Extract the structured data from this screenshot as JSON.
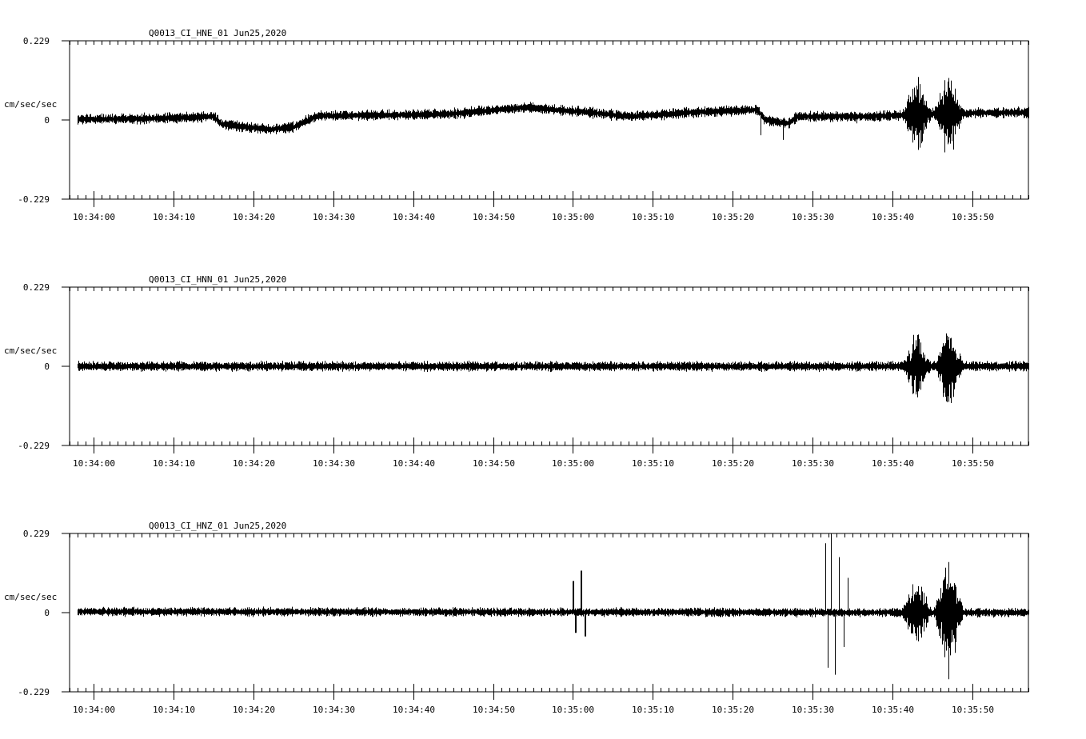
{
  "chart_data": [
    {
      "type": "line",
      "title": "Q0013_CI_HNE_01  Jun25,2020",
      "ylabel": "cm/sec/sec",
      "ylim": [
        -0.229,
        0.229
      ],
      "yticks": [
        "0.229",
        "0",
        "-0.229"
      ],
      "xlim": [
        "10:33:57",
        "10:35:57"
      ],
      "xticks": [
        "10:34:00",
        "10:34:10",
        "10:34:20",
        "10:34:30",
        "10:34:40",
        "10:34:50",
        "10:35:00",
        "10:35:10",
        "10:35:20",
        "10:35:30",
        "10:35:40",
        "10:35:50"
      ],
      "grid": false,
      "series": [
        {
          "color": "#000000",
          "trace_start_s": 1.0,
          "trace_end_s": 120.0,
          "baseline": [
            [
              1.0,
              0.002
            ],
            [
              10,
              0.004
            ],
            [
              18,
              0.01
            ],
            [
              19,
              -0.012
            ],
            [
              22,
              -0.02
            ],
            [
              25,
              -0.028
            ],
            [
              28,
              -0.02
            ],
            [
              31,
              0.012
            ],
            [
              40,
              0.014
            ],
            [
              48,
              0.018
            ],
            [
              57,
              0.036
            ],
            [
              65,
              0.022
            ],
            [
              70,
              0.01
            ],
            [
              78,
              0.022
            ],
            [
              86,
              0.03
            ],
            [
              87,
              0.0
            ],
            [
              90,
              -0.01
            ],
            [
              91,
              0.01
            ],
            [
              100,
              0.01
            ],
            [
              108,
              0.018
            ],
            [
              120,
              0.022
            ]
          ],
          "noise_amplitude": 0.013,
          "spikes": [
            [
              86.5,
              -0.06
            ],
            [
              89.3,
              -0.05
            ],
            [
              98.5,
              -0.02
            ]
          ],
          "bursts": [
            [
              104.0,
              108.0,
              0.14
            ],
            [
              108.0,
              112.0,
              0.16
            ]
          ]
        }
      ]
    },
    {
      "type": "line",
      "title": "Q0013_CI_HNN_01  Jun25,2020",
      "ylabel": "cm/sec/sec",
      "ylim": [
        -0.229,
        0.229
      ],
      "yticks": [
        "0.229",
        "0",
        "-0.229"
      ],
      "xlim": [
        "10:33:57",
        "10:35:57"
      ],
      "xticks": [
        "10:34:00",
        "10:34:10",
        "10:34:20",
        "10:34:30",
        "10:34:40",
        "10:34:50",
        "10:35:00",
        "10:35:10",
        "10:35:20",
        "10:35:30",
        "10:35:40",
        "10:35:50"
      ],
      "grid": false,
      "series": [
        {
          "color": "#000000",
          "trace_start_s": 1.0,
          "trace_end_s": 120.0,
          "baseline": [
            [
              1.0,
              0.0
            ],
            [
              120,
              0.0
            ]
          ],
          "noise_amplitude": 0.012,
          "spikes": [],
          "bursts": [
            [
              104.0,
              108.0,
              0.12
            ],
            [
              108.0,
              112.0,
              0.14
            ]
          ]
        }
      ]
    },
    {
      "type": "line",
      "title": "Q0013_CI_HNZ_01  Jun25,2020",
      "ylabel": "cm/sec/sec",
      "ylim": [
        -0.229,
        0.229
      ],
      "yticks": [
        "0.229",
        "0",
        "-0.229"
      ],
      "xlim": [
        "10:33:57",
        "10:35:57"
      ],
      "xticks": [
        "10:34:00",
        "10:34:10",
        "10:34:20",
        "10:34:30",
        "10:34:40",
        "10:34:50",
        "10:35:00",
        "10:35:10",
        "10:35:20",
        "10:35:30",
        "10:35:40",
        "10:35:50"
      ],
      "grid": false,
      "series": [
        {
          "color": "#000000",
          "trace_start_s": 1.0,
          "trace_end_s": 120.0,
          "baseline": [
            [
              1.0,
              0.003
            ],
            [
              120,
              0.0
            ]
          ],
          "noise_amplitude": 0.011,
          "spikes": [
            [
              63.0,
              0.09
            ],
            [
              63.3,
              -0.06
            ],
            [
              64.0,
              0.12
            ],
            [
              64.5,
              -0.07
            ],
            [
              94.6,
              0.2
            ],
            [
              94.9,
              -0.16
            ],
            [
              95.3,
              0.23
            ],
            [
              95.8,
              -0.18
            ],
            [
              96.3,
              0.16
            ],
            [
              96.9,
              -0.1
            ],
            [
              97.4,
              0.1
            ]
          ],
          "bursts": [
            [
              104.0,
              108.0,
              0.14
            ],
            [
              108.0,
              112.0,
              0.2
            ]
          ]
        }
      ]
    }
  ]
}
